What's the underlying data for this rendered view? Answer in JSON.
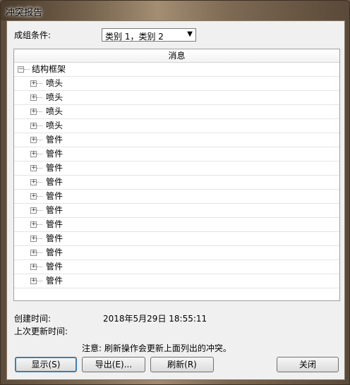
{
  "window": {
    "title": "冲突报告"
  },
  "group": {
    "label": "成组条件:",
    "selected": "类别 1，类别 2"
  },
  "list": {
    "header": "消息",
    "root": "结构框架",
    "children": [
      "喷头",
      "喷头",
      "喷头",
      "喷头",
      "管件",
      "管件",
      "管件",
      "管件",
      "管件",
      "管件",
      "管件",
      "管件",
      "管件",
      "管件",
      "管件"
    ]
  },
  "info": {
    "created_label": "创建时间:",
    "created_value": "2018年5月29日  18:55:11",
    "updated_label": "上次更新时间:",
    "note": "注意: 刷新操作会更新上面列出的冲突。"
  },
  "buttons": {
    "show": "显示(S)",
    "export": "导出(E)...",
    "refresh": "刷新(R)",
    "close": "关闭"
  }
}
